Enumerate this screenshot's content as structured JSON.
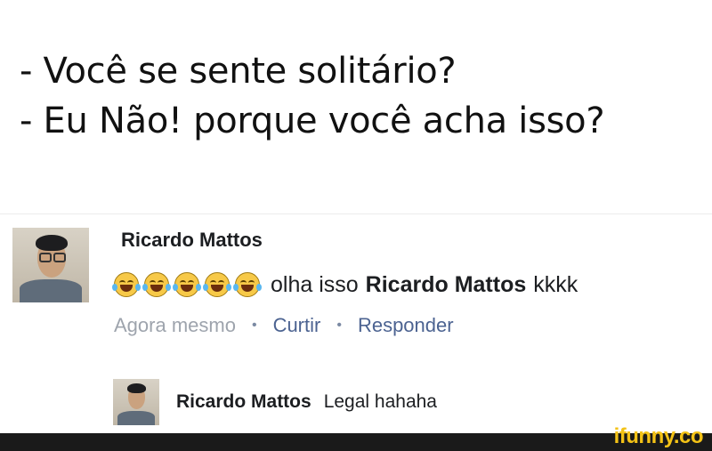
{
  "caption": {
    "line1": "- Você se sente solitário?",
    "line2": "- Eu Não! porque você acha isso?"
  },
  "comment": {
    "author": "Ricardo Mattos",
    "emoji_icons": [
      "laughing-tears-emoji",
      "laughing-tears-emoji",
      "laughing-tears-emoji",
      "laughing-tears-emoji",
      "laughing-tears-emoji"
    ],
    "text": "olha isso",
    "mention": "Ricardo Mattos",
    "suffix": "kkkk",
    "time": "Agora mesmo",
    "like_label": "Curtir",
    "reply_label": "Responder",
    "separator": "•"
  },
  "reply": {
    "author": "Ricardo Mattos",
    "text": "Legal hahaha"
  },
  "watermark": {
    "text": "ifunny.co"
  },
  "colors": {
    "link": "#4c6391",
    "time": "#9ea4ad",
    "watermark": "#f3c216"
  }
}
